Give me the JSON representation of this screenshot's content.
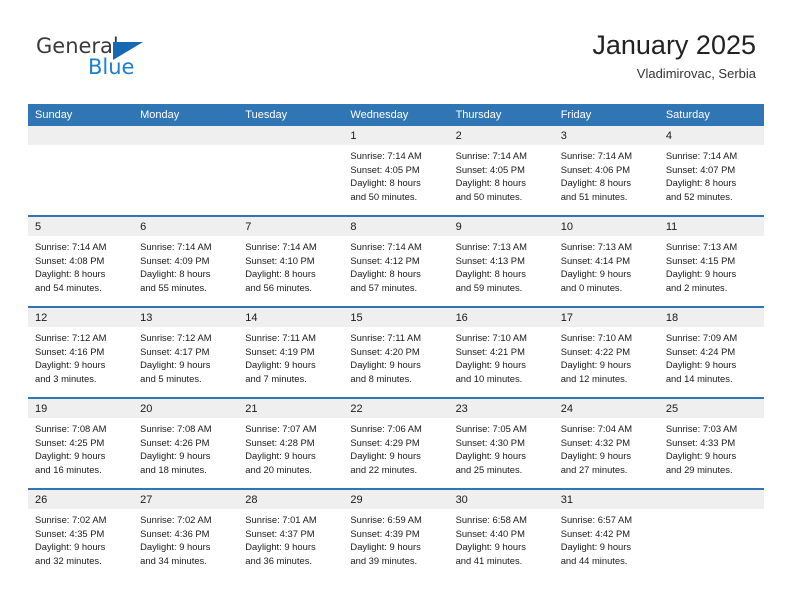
{
  "brand": {
    "name_part1": "General",
    "name_part2": "Blue",
    "triangle_icon": "blue-triangle-logo-icon",
    "colors": {
      "dark": "#3a3a3a",
      "blue": "#1b7fd4",
      "triangle": "#1668b3"
    }
  },
  "header": {
    "title": "January 2025",
    "subtitle": "Vladimirovac, Serbia"
  },
  "theme": {
    "header_blue": "#3075b4",
    "daynum_band": "#efefef",
    "cell_background": "#ffffff"
  },
  "calendar": {
    "weekday_headers": [
      "Sunday",
      "Monday",
      "Tuesday",
      "Wednesday",
      "Thursday",
      "Friday",
      "Saturday"
    ],
    "weeks": [
      [
        {
          "day": "",
          "sunrise": "",
          "sunset": "",
          "daylight_line1": "",
          "daylight_line2": ""
        },
        {
          "day": "",
          "sunrise": "",
          "sunset": "",
          "daylight_line1": "",
          "daylight_line2": ""
        },
        {
          "day": "",
          "sunrise": "",
          "sunset": "",
          "daylight_line1": "",
          "daylight_line2": ""
        },
        {
          "day": "1",
          "sunrise": "Sunrise: 7:14 AM",
          "sunset": "Sunset: 4:05 PM",
          "daylight_line1": "Daylight: 8 hours",
          "daylight_line2": "and 50 minutes."
        },
        {
          "day": "2",
          "sunrise": "Sunrise: 7:14 AM",
          "sunset": "Sunset: 4:05 PM",
          "daylight_line1": "Daylight: 8 hours",
          "daylight_line2": "and 50 minutes."
        },
        {
          "day": "3",
          "sunrise": "Sunrise: 7:14 AM",
          "sunset": "Sunset: 4:06 PM",
          "daylight_line1": "Daylight: 8 hours",
          "daylight_line2": "and 51 minutes."
        },
        {
          "day": "4",
          "sunrise": "Sunrise: 7:14 AM",
          "sunset": "Sunset: 4:07 PM",
          "daylight_line1": "Daylight: 8 hours",
          "daylight_line2": "and 52 minutes."
        }
      ],
      [
        {
          "day": "5",
          "sunrise": "Sunrise: 7:14 AM",
          "sunset": "Sunset: 4:08 PM",
          "daylight_line1": "Daylight: 8 hours",
          "daylight_line2": "and 54 minutes."
        },
        {
          "day": "6",
          "sunrise": "Sunrise: 7:14 AM",
          "sunset": "Sunset: 4:09 PM",
          "daylight_line1": "Daylight: 8 hours",
          "daylight_line2": "and 55 minutes."
        },
        {
          "day": "7",
          "sunrise": "Sunrise: 7:14 AM",
          "sunset": "Sunset: 4:10 PM",
          "daylight_line1": "Daylight: 8 hours",
          "daylight_line2": "and 56 minutes."
        },
        {
          "day": "8",
          "sunrise": "Sunrise: 7:14 AM",
          "sunset": "Sunset: 4:12 PM",
          "daylight_line1": "Daylight: 8 hours",
          "daylight_line2": "and 57 minutes."
        },
        {
          "day": "9",
          "sunrise": "Sunrise: 7:13 AM",
          "sunset": "Sunset: 4:13 PM",
          "daylight_line1": "Daylight: 8 hours",
          "daylight_line2": "and 59 minutes."
        },
        {
          "day": "10",
          "sunrise": "Sunrise: 7:13 AM",
          "sunset": "Sunset: 4:14 PM",
          "daylight_line1": "Daylight: 9 hours",
          "daylight_line2": "and 0 minutes."
        },
        {
          "day": "11",
          "sunrise": "Sunrise: 7:13 AM",
          "sunset": "Sunset: 4:15 PM",
          "daylight_line1": "Daylight: 9 hours",
          "daylight_line2": "and 2 minutes."
        }
      ],
      [
        {
          "day": "12",
          "sunrise": "Sunrise: 7:12 AM",
          "sunset": "Sunset: 4:16 PM",
          "daylight_line1": "Daylight: 9 hours",
          "daylight_line2": "and 3 minutes."
        },
        {
          "day": "13",
          "sunrise": "Sunrise: 7:12 AM",
          "sunset": "Sunset: 4:17 PM",
          "daylight_line1": "Daylight: 9 hours",
          "daylight_line2": "and 5 minutes."
        },
        {
          "day": "14",
          "sunrise": "Sunrise: 7:11 AM",
          "sunset": "Sunset: 4:19 PM",
          "daylight_line1": "Daylight: 9 hours",
          "daylight_line2": "and 7 minutes."
        },
        {
          "day": "15",
          "sunrise": "Sunrise: 7:11 AM",
          "sunset": "Sunset: 4:20 PM",
          "daylight_line1": "Daylight: 9 hours",
          "daylight_line2": "and 8 minutes."
        },
        {
          "day": "16",
          "sunrise": "Sunrise: 7:10 AM",
          "sunset": "Sunset: 4:21 PM",
          "daylight_line1": "Daylight: 9 hours",
          "daylight_line2": "and 10 minutes."
        },
        {
          "day": "17",
          "sunrise": "Sunrise: 7:10 AM",
          "sunset": "Sunset: 4:22 PM",
          "daylight_line1": "Daylight: 9 hours",
          "daylight_line2": "and 12 minutes."
        },
        {
          "day": "18",
          "sunrise": "Sunrise: 7:09 AM",
          "sunset": "Sunset: 4:24 PM",
          "daylight_line1": "Daylight: 9 hours",
          "daylight_line2": "and 14 minutes."
        }
      ],
      [
        {
          "day": "19",
          "sunrise": "Sunrise: 7:08 AM",
          "sunset": "Sunset: 4:25 PM",
          "daylight_line1": "Daylight: 9 hours",
          "daylight_line2": "and 16 minutes."
        },
        {
          "day": "20",
          "sunrise": "Sunrise: 7:08 AM",
          "sunset": "Sunset: 4:26 PM",
          "daylight_line1": "Daylight: 9 hours",
          "daylight_line2": "and 18 minutes."
        },
        {
          "day": "21",
          "sunrise": "Sunrise: 7:07 AM",
          "sunset": "Sunset: 4:28 PM",
          "daylight_line1": "Daylight: 9 hours",
          "daylight_line2": "and 20 minutes."
        },
        {
          "day": "22",
          "sunrise": "Sunrise: 7:06 AM",
          "sunset": "Sunset: 4:29 PM",
          "daylight_line1": "Daylight: 9 hours",
          "daylight_line2": "and 22 minutes."
        },
        {
          "day": "23",
          "sunrise": "Sunrise: 7:05 AM",
          "sunset": "Sunset: 4:30 PM",
          "daylight_line1": "Daylight: 9 hours",
          "daylight_line2": "and 25 minutes."
        },
        {
          "day": "24",
          "sunrise": "Sunrise: 7:04 AM",
          "sunset": "Sunset: 4:32 PM",
          "daylight_line1": "Daylight: 9 hours",
          "daylight_line2": "and 27 minutes."
        },
        {
          "day": "25",
          "sunrise": "Sunrise: 7:03 AM",
          "sunset": "Sunset: 4:33 PM",
          "daylight_line1": "Daylight: 9 hours",
          "daylight_line2": "and 29 minutes."
        }
      ],
      [
        {
          "day": "26",
          "sunrise": "Sunrise: 7:02 AM",
          "sunset": "Sunset: 4:35 PM",
          "daylight_line1": "Daylight: 9 hours",
          "daylight_line2": "and 32 minutes."
        },
        {
          "day": "27",
          "sunrise": "Sunrise: 7:02 AM",
          "sunset": "Sunset: 4:36 PM",
          "daylight_line1": "Daylight: 9 hours",
          "daylight_line2": "and 34 minutes."
        },
        {
          "day": "28",
          "sunrise": "Sunrise: 7:01 AM",
          "sunset": "Sunset: 4:37 PM",
          "daylight_line1": "Daylight: 9 hours",
          "daylight_line2": "and 36 minutes."
        },
        {
          "day": "29",
          "sunrise": "Sunrise: 6:59 AM",
          "sunset": "Sunset: 4:39 PM",
          "daylight_line1": "Daylight: 9 hours",
          "daylight_line2": "and 39 minutes."
        },
        {
          "day": "30",
          "sunrise": "Sunrise: 6:58 AM",
          "sunset": "Sunset: 4:40 PM",
          "daylight_line1": "Daylight: 9 hours",
          "daylight_line2": "and 41 minutes."
        },
        {
          "day": "31",
          "sunrise": "Sunrise: 6:57 AM",
          "sunset": "Sunset: 4:42 PM",
          "daylight_line1": "Daylight: 9 hours",
          "daylight_line2": "and 44 minutes."
        },
        {
          "day": "",
          "sunrise": "",
          "sunset": "",
          "daylight_line1": "",
          "daylight_line2": ""
        }
      ]
    ]
  }
}
